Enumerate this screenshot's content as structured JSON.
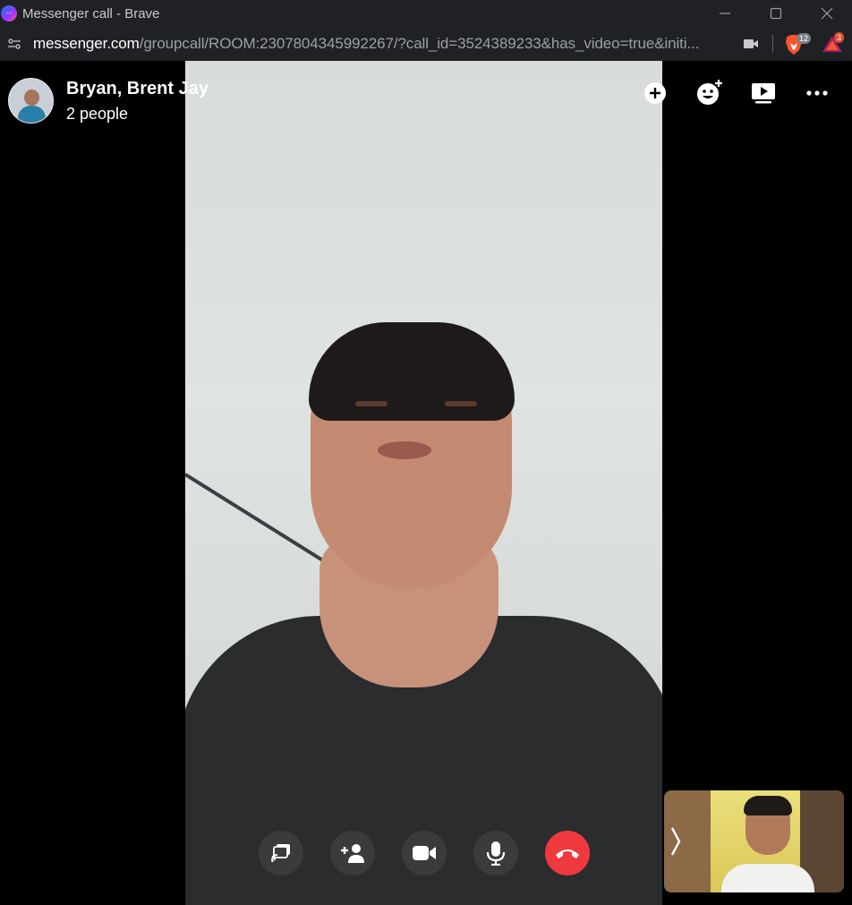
{
  "window": {
    "title": "Messenger call - Brave"
  },
  "address_bar": {
    "url_host": "messenger.com",
    "url_path": "/groupcall/ROOM:2307804345992267/?call_id=3524389233&has_video=true&initi...",
    "shield_count": "12",
    "rewards_count": "3"
  },
  "call": {
    "name": "Bryan, Brent Jay",
    "participants": "2 people"
  },
  "colors": {
    "end_call": "#f0383f",
    "control_bg": "#3a3b3c",
    "brave_orange": "#fb542b"
  },
  "icons": {
    "top_actions": [
      "add-icon",
      "effects-icon",
      "watch-together-icon",
      "more-icon"
    ],
    "controls": [
      "share-screen-icon",
      "add-person-icon",
      "camera-icon",
      "microphone-icon",
      "end-call-icon"
    ]
  }
}
